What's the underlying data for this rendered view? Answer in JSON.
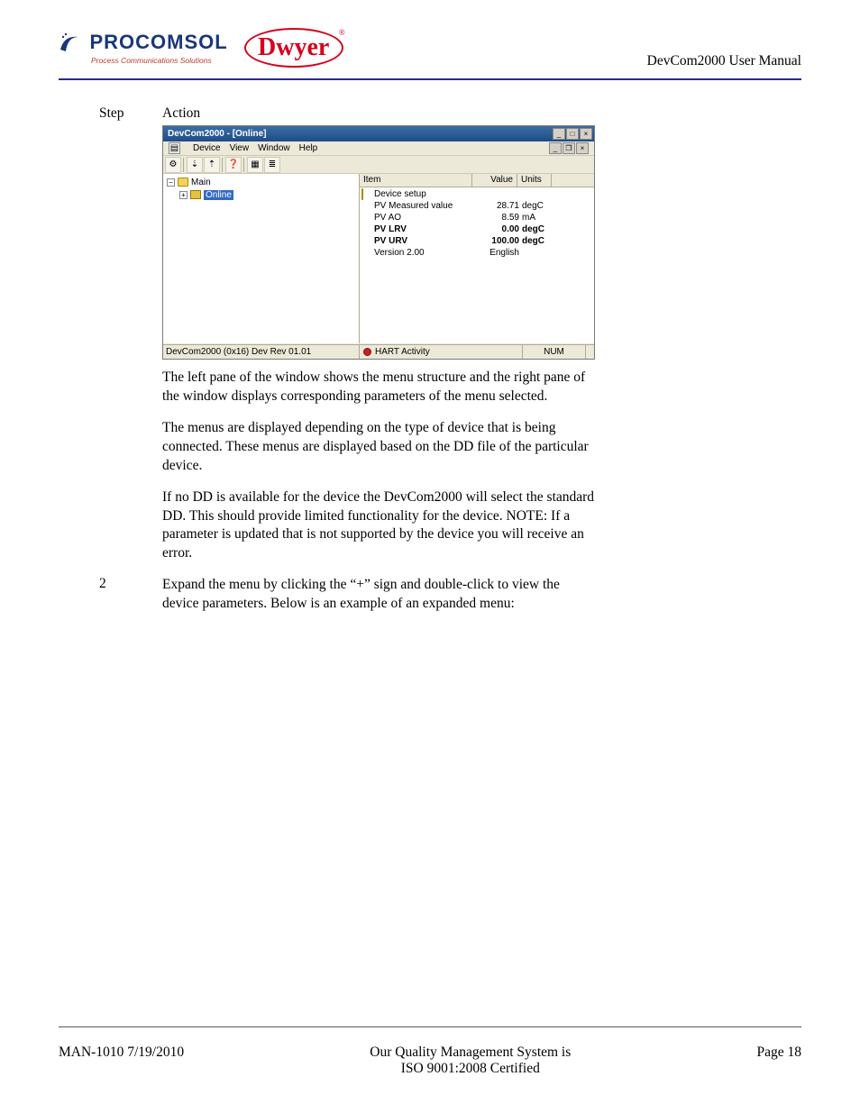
{
  "header": {
    "procomsol_name": "PROCOMSOL",
    "procomsol_tagline": "Process Communications Solutions",
    "dwyer_name": "Dwyer",
    "doc_title": "DevCom2000 User Manual"
  },
  "cols": {
    "step": "Step",
    "action": "Action"
  },
  "screenshot": {
    "title": "DevCom2000 - [Online]",
    "menu": {
      "device": "Device",
      "view": "View",
      "window": "Window",
      "help": "Help"
    },
    "tree": {
      "main": "Main",
      "online": "Online"
    },
    "list": {
      "headers": {
        "item": "Item",
        "value": "Value",
        "units": "Units"
      },
      "rows": [
        {
          "item": "Device setup",
          "value": "",
          "units": "",
          "bold": false,
          "icon": "folder"
        },
        {
          "item": "PV Measured value",
          "value": "28.71",
          "units": "degC",
          "bold": false,
          "icon": "cog"
        },
        {
          "item": "PV AO",
          "value": "8.59",
          "units": "mA",
          "bold": false,
          "icon": "cog"
        },
        {
          "item": "PV LRV",
          "value": "0.00",
          "units": "degC",
          "bold": true,
          "icon": "cog"
        },
        {
          "item": "PV URV",
          "value": "100.00",
          "units": "degC",
          "bold": true,
          "icon": "cog"
        },
        {
          "item": "Version 2.00",
          "value": "English",
          "units": "",
          "bold": false,
          "icon": "cog"
        }
      ]
    },
    "status": {
      "left": "DevCom2000  (0x16)  Dev Rev 01.01",
      "mid": "HART Activity",
      "right": "NUM"
    }
  },
  "paragraphs": {
    "p1": "The left pane of the window shows the menu structure and the right pane of the window displays corresponding parameters of the menu selected.",
    "p2": "The menus are displayed depending on the type of device that is being connected. These menus are displayed based on the DD file of the particular device.",
    "p3": "If no DD is available for the device the DevCom2000 will select the standard DD.  This should provide limited functionality for the device.  NOTE: If a parameter is updated that is not supported by the device you will receive an error."
  },
  "step2": {
    "num": "2",
    "text": "Expand the menu by clicking the “+” sign and double-click to view the device parameters. Below is an example of an expanded menu:"
  },
  "footer": {
    "left": "MAN-1010 7/19/2010",
    "center1": "Our Quality Management System is",
    "center2": "ISO 9001:2008 Certified",
    "right": "Page 18"
  }
}
